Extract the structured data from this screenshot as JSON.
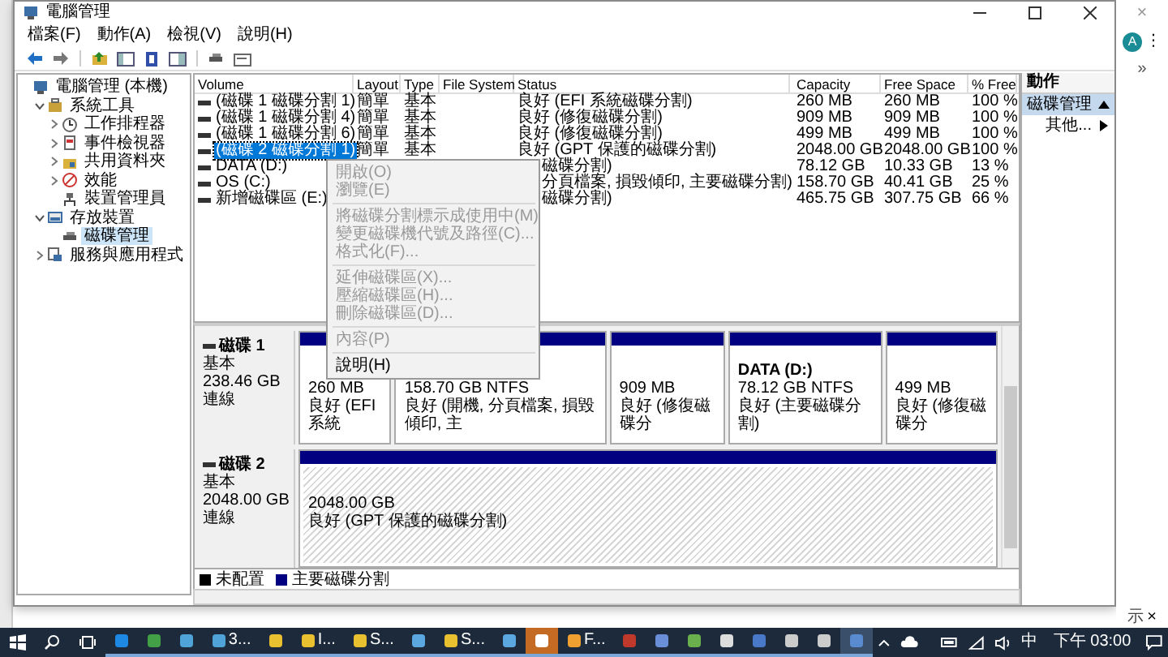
{
  "window": {
    "title": "電腦管理"
  },
  "menu_bar": [
    {
      "label": "檔案(F)"
    },
    {
      "label": "動作(A)"
    },
    {
      "label": "檢視(V)"
    },
    {
      "label": "說明(H)"
    }
  ],
  "tree": [
    {
      "label": "電腦管理 (本機)",
      "selected": false,
      "children": [
        {
          "label": "系統工具",
          "expanded": true,
          "selected": false,
          "children": [
            {
              "label": "工作排程器",
              "expanded": false,
              "selected": false
            },
            {
              "label": "事件檢視器",
              "expanded": false,
              "selected": false
            },
            {
              "label": "共用資料夾",
              "expanded": false,
              "selected": false
            },
            {
              "label": "效能",
              "expanded": false,
              "selected": false
            },
            {
              "label": "裝置管理員",
              "selected": false
            }
          ]
        },
        {
          "label": "存放裝置",
          "expanded": true,
          "selected": false,
          "children": [
            {
              "label": "磁碟管理",
              "selected": true
            }
          ]
        },
        {
          "label": "服務與應用程式",
          "expanded": false,
          "selected": false
        }
      ]
    }
  ],
  "volume_list": {
    "columns": [
      "Volume",
      "Layout",
      "Type",
      "File System",
      "Status",
      "Capacity",
      "Free Space",
      "% Free"
    ],
    "rows": [
      {
        "volume": "(磁碟 1 磁碟分割 1)",
        "layout": "簡單",
        "type": "基本",
        "status": "良好 (EFI 系統磁碟分割)",
        "capacity": "260 MB",
        "free_space": "260 MB",
        "percent_free": "100 %",
        "selected": false
      },
      {
        "volume": "(磁碟 1 磁碟分割 4)",
        "layout": "簡單",
        "type": "基本",
        "status": "良好 (修復磁碟分割)",
        "capacity": "909 MB",
        "free_space": "909 MB",
        "percent_free": "100 %",
        "selected": false
      },
      {
        "volume": "(磁碟 1 磁碟分割 6)",
        "layout": "簡單",
        "type": "基本",
        "status": "良好 (修復磁碟分割)",
        "capacity": "499 MB",
        "free_space": "499 MB",
        "percent_free": "100 %",
        "selected": false
      },
      {
        "volume": "(磁碟 2 磁碟分割 1)",
        "layout": "簡單",
        "type": "基本",
        "status": "良好 (GPT 保護的磁碟分割)",
        "capacity": "2048.00 GB",
        "free_space": "2048.00 GB",
        "percent_free": "100 %",
        "selected": true
      },
      {
        "volume": "DATA (D:)",
        "status": "磁碟分割)",
        "capacity": "78.12 GB",
        "free_space": "10.33 GB",
        "percent_free": "13 %",
        "selected": false
      },
      {
        "volume": "OS (C:)",
        "status": "分頁檔案, 損毀傾印, 主要磁碟分割)",
        "capacity": "158.70 GB",
        "free_space": "40.41 GB",
        "percent_free": "25 %",
        "selected": false
      },
      {
        "volume": "新增磁碟區 (E:)",
        "status": "磁碟分割)",
        "capacity": "465.75 GB",
        "free_space": "307.75 GB",
        "percent_free": "66 %",
        "selected": false
      }
    ]
  },
  "context_menu": {
    "items": [
      {
        "kind": "item",
        "label": "開啟(O)",
        "disabled": true
      },
      {
        "kind": "item",
        "label": "瀏覽(E)",
        "disabled": true
      },
      {
        "kind": "separator"
      },
      {
        "kind": "item",
        "label": "將磁碟分割標示成使用中(M)",
        "disabled": true
      },
      {
        "kind": "item",
        "label": "變更磁碟機代號及路徑(C)...",
        "disabled": true
      },
      {
        "kind": "item",
        "label": "格式化(F)...",
        "disabled": true
      },
      {
        "kind": "separator"
      },
      {
        "kind": "item",
        "label": "延伸磁碟區(X)...",
        "disabled": true
      },
      {
        "kind": "item",
        "label": "壓縮磁碟區(H)...",
        "disabled": true
      },
      {
        "kind": "item",
        "label": "刪除磁碟區(D)...",
        "disabled": true
      },
      {
        "kind": "separator"
      },
      {
        "kind": "item",
        "label": "內容(P)",
        "disabled": true
      },
      {
        "kind": "separator"
      },
      {
        "kind": "item",
        "label": "說明(H)",
        "disabled": false
      }
    ]
  },
  "disks": [
    {
      "name": "磁碟 1",
      "type": "基本",
      "size": "238.46 GB",
      "status": "連線",
      "partitions": [
        {
          "size": "260 MB",
          "status": "良好 (EFI 系統",
          "selected": false
        },
        {
          "size": "158.70 GB NTFS",
          "status": "良好 (開機, 分頁檔案, 損毀傾印, 主",
          "selected": false
        },
        {
          "size": "909 MB",
          "status": "良好 (修復磁碟分",
          "selected": false
        },
        {
          "title": "DATA (D:)",
          "size": "78.12 GB NTFS",
          "status": "良好 (主要磁碟分割)",
          "selected": false
        },
        {
          "size": "499 MB",
          "status": "良好 (修復磁碟分",
          "selected": false
        }
      ]
    },
    {
      "name": "磁碟 2",
      "type": "基本",
      "size": "2048.00 GB",
      "status": "連線",
      "partitions": [
        {
          "size": "2048.00 GB",
          "status": "良好 (GPT 保護的磁碟分割)",
          "selected": true
        }
      ]
    }
  ],
  "legend": [
    {
      "label": "未配置",
      "color": "#000000"
    },
    {
      "label": "主要磁碟分割",
      "color": "#000080"
    }
  ],
  "actions": {
    "title": "動作",
    "items": [
      {
        "kind": "section",
        "label": "磁碟管理"
      },
      {
        "kind": "more",
        "label": "其他..."
      }
    ]
  },
  "taskbar": {
    "apps": [
      {
        "attention": false,
        "selected": false
      },
      {
        "attention": false,
        "selected": false
      },
      {
        "attention": false,
        "selected": false
      },
      {
        "label": "3...",
        "attention": false,
        "selected": false
      },
      {
        "attention": false,
        "selected": false
      },
      {
        "label": "I...",
        "attention": false,
        "selected": false
      },
      {
        "label": "S...",
        "attention": false,
        "selected": false
      },
      {
        "attention": false,
        "selected": false
      },
      {
        "label": "S...",
        "attention": false,
        "selected": false
      },
      {
        "attention": false,
        "selected": false
      },
      {
        "attention": true,
        "selected": false
      },
      {
        "label": "F...",
        "attention": false,
        "selected": false
      },
      {
        "attention": false,
        "selected": false
      },
      {
        "attention": false,
        "selected": false
      },
      {
        "attention": false,
        "selected": false
      },
      {
        "attention": false,
        "selected": false
      },
      {
        "attention": false,
        "selected": false
      },
      {
        "attention": false,
        "selected": false
      },
      {
        "attention": false,
        "selected": false
      },
      {
        "attention": false,
        "selected": true
      }
    ],
    "ime": "中",
    "clock": "下午 03:00"
  },
  "background_browser": {
    "close_top": "×",
    "avatar": "A",
    "more_menu": "⋮",
    "overflow": "»",
    "bottom_text": "示",
    "close_bottom": "×"
  }
}
